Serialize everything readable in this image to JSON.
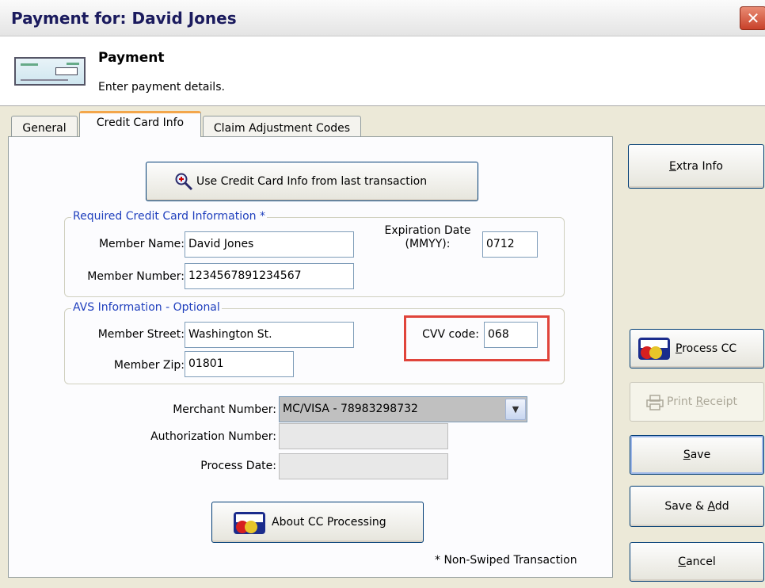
{
  "window": {
    "title": "Payment for: David Jones",
    "close_glyph": "✕"
  },
  "header": {
    "title": "Payment",
    "subtitle": "Enter payment details.",
    "icon": "check-icon"
  },
  "tabs": [
    {
      "label": "General",
      "active": false
    },
    {
      "label": "Credit Card Info",
      "active": true
    },
    {
      "label": "Claim Adjustment Codes",
      "active": false
    }
  ],
  "panel": {
    "use_last_button": "Use Credit Card Info from last transaction",
    "required_group": {
      "legend": "Required Credit Card Information *",
      "member_name_label": "Member Name:",
      "member_name_value": "David Jones",
      "member_number_label": "Member Number:",
      "member_number_value": "1234567891234567",
      "expiration_label_1": "Expiration Date",
      "expiration_label_2": "(MMYY):",
      "expiration_value": "0712"
    },
    "avs_group": {
      "legend": "AVS Information - Optional",
      "street_label": "Member Street:",
      "street_value": "Washington St.",
      "zip_label": "Member Zip:",
      "zip_value": "01801",
      "cvv_label": "CVV code:",
      "cvv_value": "068"
    },
    "merchant_label": "Merchant Number:",
    "merchant_value": "MC/VISA - 78983298732",
    "authorization_label": "Authorization Number:",
    "authorization_value": "",
    "process_date_label": "Process Date:",
    "process_date_value": "",
    "about_button": "About CC Processing",
    "footnote": "* Non-Swiped Transaction"
  },
  "side_buttons": {
    "extra_info": {
      "pre": "",
      "u": "E",
      "post": "xtra Info"
    },
    "process_cc": {
      "pre": "",
      "u": "P",
      "post": "rocess CC"
    },
    "print_receipt": {
      "pre": "Print ",
      "u": "R",
      "post": "eceipt"
    },
    "save": {
      "pre": "",
      "u": "S",
      "post": "ave"
    },
    "save_add": {
      "pre": "Save & ",
      "u": "A",
      "post": "dd"
    },
    "cancel": {
      "pre": "",
      "u": "C",
      "post": "ancel"
    }
  },
  "colors": {
    "legend": "#1f3fbd",
    "highlight": "#e0443b",
    "tab_active_accent": "#f3a64b"
  }
}
